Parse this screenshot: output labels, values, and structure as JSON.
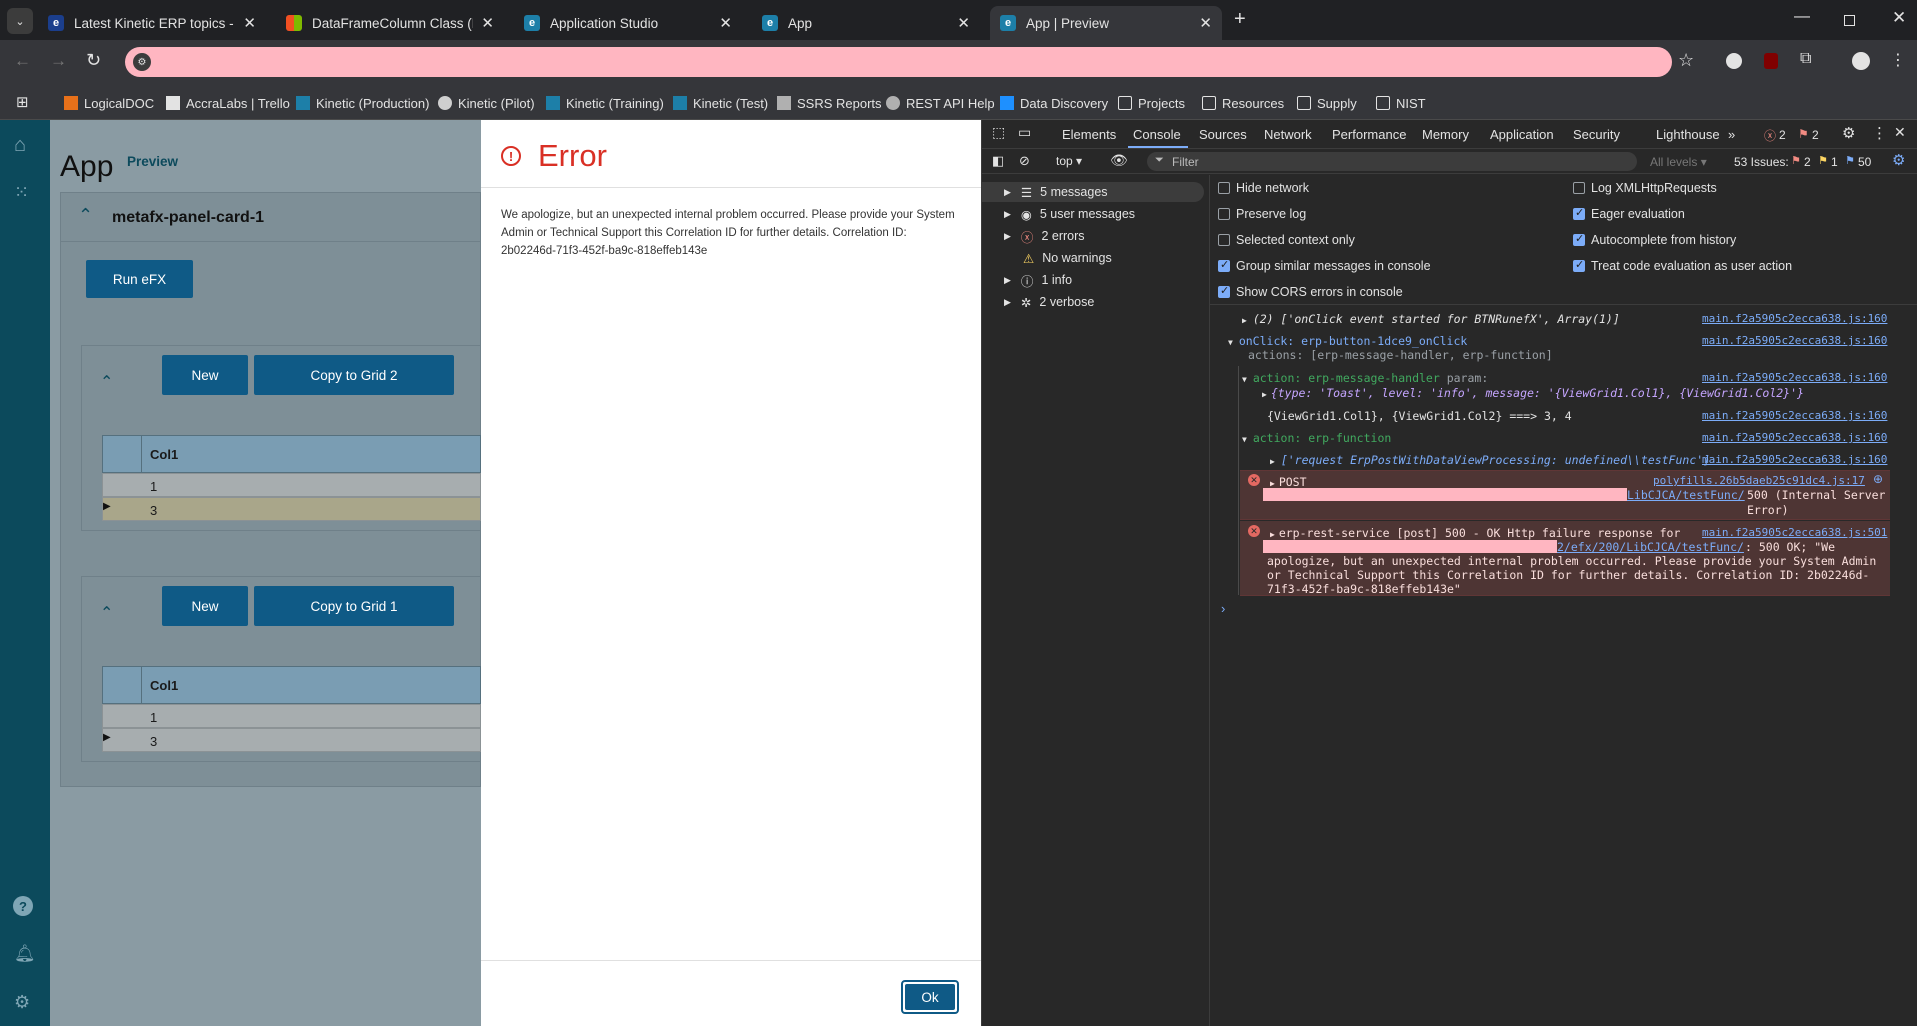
{
  "tabs": [
    {
      "title": "Latest Kinetic ERP topics - Epicor",
      "fav_color": "#1b3e8c"
    },
    {
      "title": "DataFrameColumn Class (Microsoft",
      "fav_color": "#f25022"
    },
    {
      "title": "Application Studio",
      "fav_color": "#1d7fa8"
    },
    {
      "title": "App",
      "fav_color": "#1d7fa8"
    },
    {
      "title": "App | Preview",
      "fav_color": "#1d7fa8"
    }
  ],
  "bookmarks": [
    "LogicalDOC",
    "AccraLabs | Trello",
    "Kinetic (Production)",
    "Kinetic (Pilot)",
    "Kinetic (Training)",
    "Kinetic (Test)",
    "SSRS Reports",
    "REST API Help",
    "Data Discovery",
    "Projects",
    "Resources",
    "Supply",
    "NIST"
  ],
  "app": {
    "title": "App",
    "subtitle": "Preview",
    "panel_title": "metafx-panel-card-1",
    "run_button": "Run eFX",
    "grid1": {
      "new_button": "New",
      "copy_button": "Copy to Grid 2",
      "column": "Col1",
      "rows": [
        "1",
        "3"
      ]
    },
    "grid2": {
      "new_button": "New",
      "copy_button": "Copy to Grid 1",
      "column": "Col1",
      "rows": [
        "1",
        "3"
      ]
    }
  },
  "dialog": {
    "title": "Error",
    "message": "We apologize, but an unexpected internal problem occurred. Please provide your System Admin or Technical Support this Correlation ID for further details. Correlation ID: 2b02246d-71f3-452f-ba9c-818effeb143e",
    "ok_button": "Ok"
  },
  "devtools": {
    "tabs": [
      "Elements",
      "Console",
      "Sources",
      "Network",
      "Performance",
      "Memory",
      "Application",
      "Security",
      "Lighthouse"
    ],
    "active_tab": "Console",
    "error_count": "2",
    "warn_count": "2",
    "context": "top",
    "filter_placeholder": "Filter",
    "levels": "All levels",
    "issues": {
      "label": "53 Issues:",
      "errors": "2",
      "warnings": "1",
      "info": "50"
    },
    "sidebar": [
      {
        "label": "5 messages",
        "icon": "list-icon"
      },
      {
        "label": "5 user messages",
        "icon": "user-icon"
      },
      {
        "label": "2 errors",
        "icon": "error-icon"
      },
      {
        "label": "No warnings",
        "icon": "warning-icon"
      },
      {
        "label": "1 info",
        "icon": "info-icon"
      },
      {
        "label": "2 verbose",
        "icon": "bug-icon"
      }
    ],
    "settings_left": [
      {
        "label": "Hide network",
        "checked": false
      },
      {
        "label": "Preserve log",
        "checked": false
      },
      {
        "label": "Selected context only",
        "checked": false
      },
      {
        "label": "Group similar messages in console",
        "checked": true
      },
      {
        "label": "Show CORS errors in console",
        "checked": true
      }
    ],
    "settings_right": [
      {
        "label": "Log XMLHttpRequests",
        "checked": false
      },
      {
        "label": "Eager evaluation",
        "checked": true
      },
      {
        "label": "Autocomplete from history",
        "checked": true
      },
      {
        "label": "Treat code evaluation as user action",
        "checked": true
      }
    ],
    "console": {
      "l1": "(2) ['onClick event started for BTNRunefX', Array(1)]",
      "src_main": "main.f2a5905c2ecca638.js:160",
      "l2a": "onClick: erp-button-1dce9_onClick",
      "l2b": "actions: [erp-message-handler, erp-function]",
      "l3": "action: erp-message-handler",
      "l3p": "param:",
      "l4": "{type: 'Toast', level: 'info', message: '{ViewGrid1.Col1}, {ViewGrid1.Col2}'}",
      "l5": "{ViewGrid1.Col1}, {ViewGrid1.Col2} ===> 3, 4",
      "l6": "action: erp-function",
      "l7": "['request ErpPostWithDataViewProcessing: undefined\\\\testFunc']",
      "e1_head": "POST",
      "e1_src": "polyfills.26b5daeb25c91dc4.js:17",
      "e1_url": "LibCJCA/testFunc/",
      "e1_tail": "500 (Internal Server Error)",
      "e2_head": "erp-rest-service [post] 500 - OK Http failure response for",
      "e2_src": "main.f2a5905c2ecca638.js:501",
      "e2_url": "2/efx/200/LibCJCA/testFunc/",
      "e2_tail": ": 500 OK; \"We apologize, but an unexpected internal problem occurred. Please provide your System Admin or Technical Support this Correlation ID for further details. Correlation ID: 2b02246d-71f3-452f-ba9c-818effeb143e\""
    }
  }
}
